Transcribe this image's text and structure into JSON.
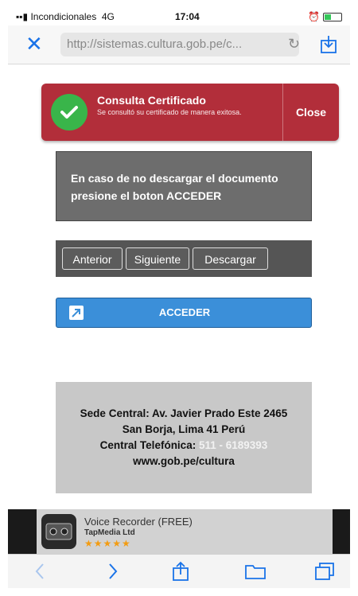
{
  "status_bar": {
    "carrier": "Incondicionales",
    "network": "4G",
    "time": "17:04"
  },
  "browser": {
    "url": "http://sistemas.cultura.gob.pe/c...",
    "close_icon": "close-icon",
    "reload_icon": "reload-icon",
    "share_icon": "share-icon"
  },
  "notification": {
    "title": "Consulta Certificado",
    "message": "Se consultó su certificado de manera exitosa.",
    "close_label": "Close",
    "icon": "check-circle-icon",
    "color": "#b22e3a"
  },
  "info": {
    "text": "En caso de no descargar el documento presione el boton ACCEDER"
  },
  "nav_buttons": {
    "previous": "Anterior",
    "next": "Siguiente",
    "download": "Descargar"
  },
  "acceder": {
    "label": "ACCEDER",
    "icon": "external-link-icon",
    "color": "#3b8fd9"
  },
  "sede": {
    "line1": "Sede Central: Av. Javier Prado Este 2465",
    "line2": "San Borja, Lima 41 Perú",
    "phone_label": "Central Telefónica:",
    "phone_number": "511 - 6189393",
    "website": "www.gob.pe/cultura"
  },
  "ad": {
    "app_name": "Voice Recorder (FREE)",
    "developer": "TapMedia Ltd",
    "stars": "★★★★★"
  },
  "toolbar": {
    "back_icon": "chevron-left-icon",
    "forward_icon": "chevron-right-icon",
    "share_icon": "share-icon",
    "bookmarks_icon": "bookmarks-icon",
    "tabs_icon": "tabs-icon"
  }
}
